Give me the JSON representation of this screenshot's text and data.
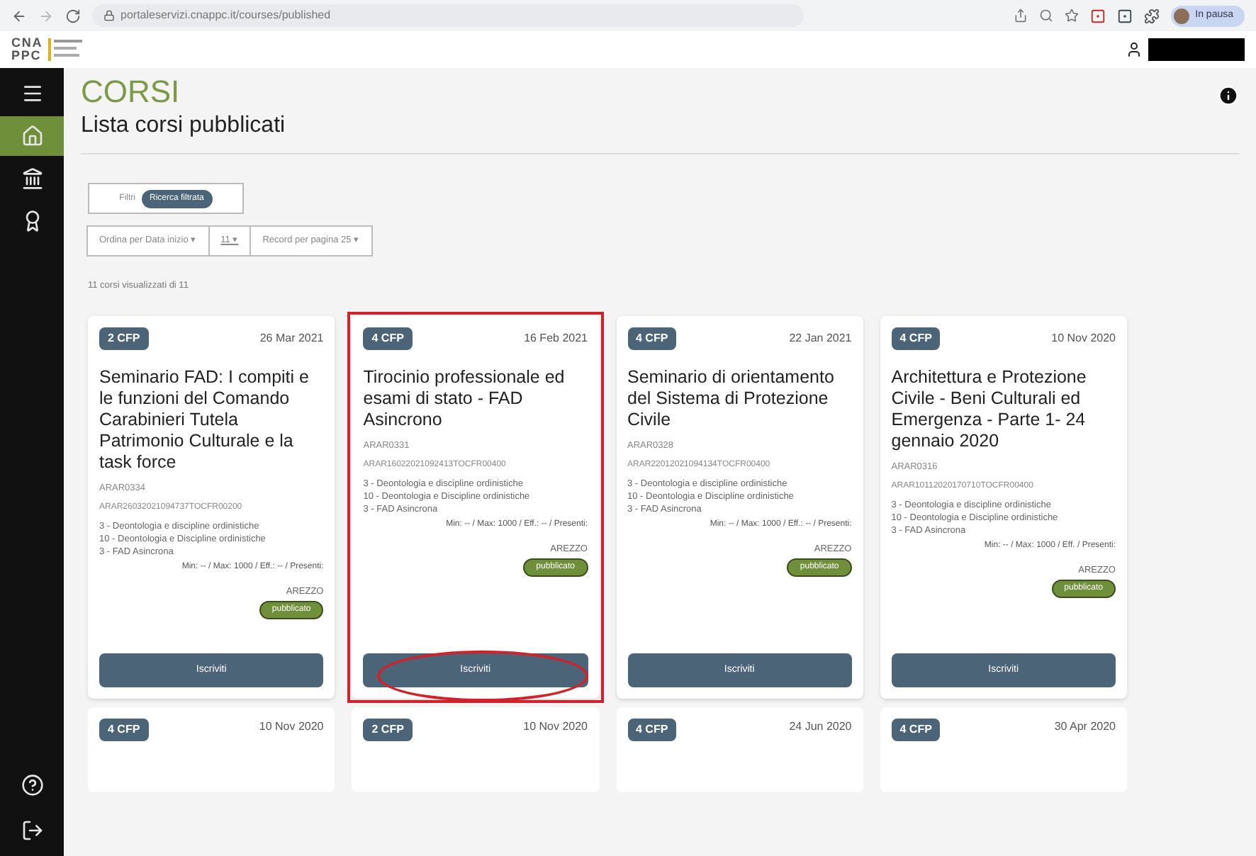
{
  "browser": {
    "url": "portaleservizi.cnappc.it/courses/published",
    "profile_label": "In pausa"
  },
  "logo": {
    "line1": "CNA",
    "line2": "PPC"
  },
  "sidebar": {
    "items": [
      {
        "kind": "menu",
        "selected": false
      },
      {
        "kind": "home",
        "selected": true
      },
      {
        "kind": "institution",
        "selected": false
      },
      {
        "kind": "award",
        "selected": false
      }
    ],
    "bottom_items": [
      {
        "kind": "help",
        "selected": false
      },
      {
        "kind": "logout",
        "selected": false
      }
    ]
  },
  "header": {
    "title": "CORSI",
    "subtitle": "Lista corsi pubblicati"
  },
  "filters": {
    "label": "Filtri",
    "chip": "Ricerca filtrata"
  },
  "dropdowns": [
    {
      "label": "Ordina per Data inizio ▾",
      "underlined": false
    },
    {
      "label": "11 ▾",
      "underlined": true
    },
    {
      "label": "Record per pagina 25 ▾",
      "underlined": false
    }
  ],
  "count": "11 corsi visualizzati di 11",
  "courses": [
    {
      "cfp": "2 CFP",
      "date": "26 Mar 2021",
      "title": "Seminario FAD: I compiti e le funzioni del Comando Carabinieri Tutela Patrimonio Culturale e la task force",
      "code": "ARAR0334",
      "long_code": "ARAR26032021094737TOCFR00200",
      "lines": [
        "3 - Deontologia e discipline ordinistiche",
        "10 - Deontologia e Discipline ordinistiche",
        "3 - FAD Asincrona"
      ],
      "capacity": "Min: -- / Max: 1000 / Eff.: -- / Presenti:",
      "city": "AREZZO",
      "status": "pubblicato",
      "button": "Iscriviti",
      "annotated": false
    },
    {
      "cfp": "4 CFP",
      "date": "16 Feb 2021",
      "title": "Tirocinio professionale ed esami di stato - FAD Asincrono",
      "code": "ARAR0331",
      "long_code": "ARAR16022021092413TOCFR00400",
      "lines": [
        "3 - Deontologia e discipline ordinistiche",
        "10 - Deontologia e Discipline ordinistiche",
        "3 - FAD Asincrona"
      ],
      "capacity": "Min: -- / Max: 1000 / Eff.: -- / Presenti:",
      "city": "AREZZO",
      "status": "pubblicato",
      "button": "Iscriviti",
      "annotated": true
    },
    {
      "cfp": "4 CFP",
      "date": "22 Jan 2021",
      "title": "Seminario di orientamento del Sistema di Protezione Civile",
      "code": "ARAR0328",
      "long_code": "ARAR22012021094134TOCFR00400",
      "lines": [
        "3 - Deontologia e discipline ordinistiche",
        "10 - Deontologia e Discipline ordinistiche",
        "3 - FAD Asincrona"
      ],
      "capacity": "Min: -- / Max: 1000 / Eff.: -- / Presenti:",
      "city": "AREZZO",
      "status": "pubblicato",
      "button": "Iscriviti",
      "annotated": false
    },
    {
      "cfp": "4 CFP",
      "date": "10 Nov 2020",
      "title": "Architettura e Protezione Civile - Beni Culturali ed Emergenza - Parte 1- 24 gennaio 2020",
      "code": "ARAR0316",
      "long_code": "ARAR10112020170710TOCFR00400",
      "lines": [
        "3 - Deontologia e discipline ordinistiche",
        "10 - Deontologia e Discipline ordinistiche",
        "3 - FAD Asincrona"
      ],
      "capacity": "Min: -- / Max: 1000 / Eff. / Presenti:",
      "city": "AREZZO",
      "status": "pubblicato",
      "button": "Iscriviti",
      "annotated": false
    }
  ],
  "more_courses": [
    {
      "cfp": "4 CFP",
      "date": "10 Nov 2020"
    },
    {
      "cfp": "2 CFP",
      "date": "10 Nov 2020"
    },
    {
      "cfp": "4 CFP",
      "date": "24 Jun 2020"
    },
    {
      "cfp": "4 CFP",
      "date": "30 Apr 2020"
    }
  ]
}
